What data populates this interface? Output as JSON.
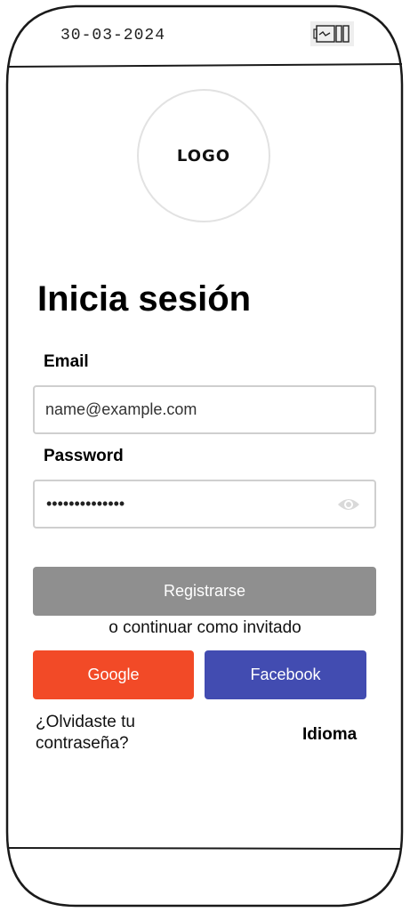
{
  "status_bar": {
    "date": "30-03-2024",
    "battery_icon": "battery-icon"
  },
  "logo": {
    "text": "LOGO"
  },
  "login": {
    "title": "Inicia sesión",
    "email_label": "Email",
    "email_value": "name@example.com",
    "password_label": "Password",
    "password_value": "••••••••••••••",
    "eye_icon": "eye-icon"
  },
  "actions": {
    "register_label": "Registrarse",
    "guest_label": "o continuar como invitado",
    "google_label": "Google",
    "facebook_label": "Facebook",
    "forgot_label": "¿Olvidaste tu contraseña?",
    "language_label": "Idioma"
  },
  "colors": {
    "register_button": "#8f8f8f",
    "google_button": "#f24a27",
    "facebook_button": "#424cb1"
  }
}
